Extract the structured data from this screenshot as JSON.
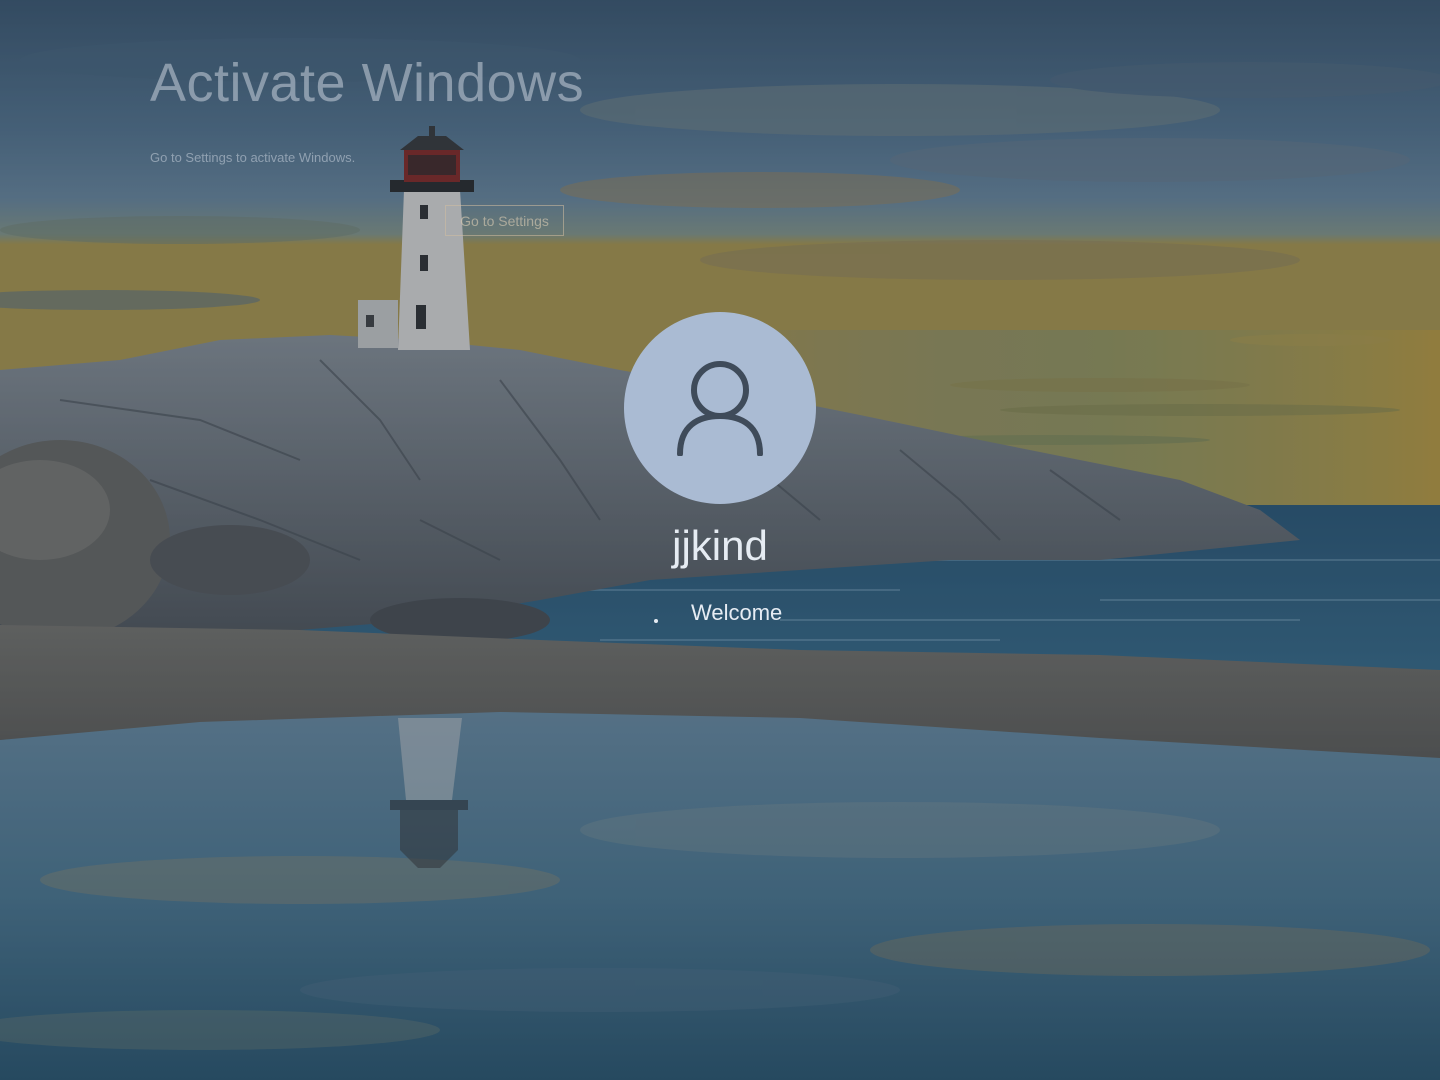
{
  "watermark": {
    "title": "Activate Windows",
    "subtitle": "Go to Settings to activate Windows.",
    "button_label": "Go to Settings"
  },
  "user": {
    "name": "jjkind",
    "avatar_icon": "user-icon"
  },
  "status": {
    "text": "Welcome"
  },
  "colors": {
    "avatar_bg": "#aabbd3",
    "avatar_icon": "#3f4b5a",
    "text": "#e6ecf3"
  }
}
